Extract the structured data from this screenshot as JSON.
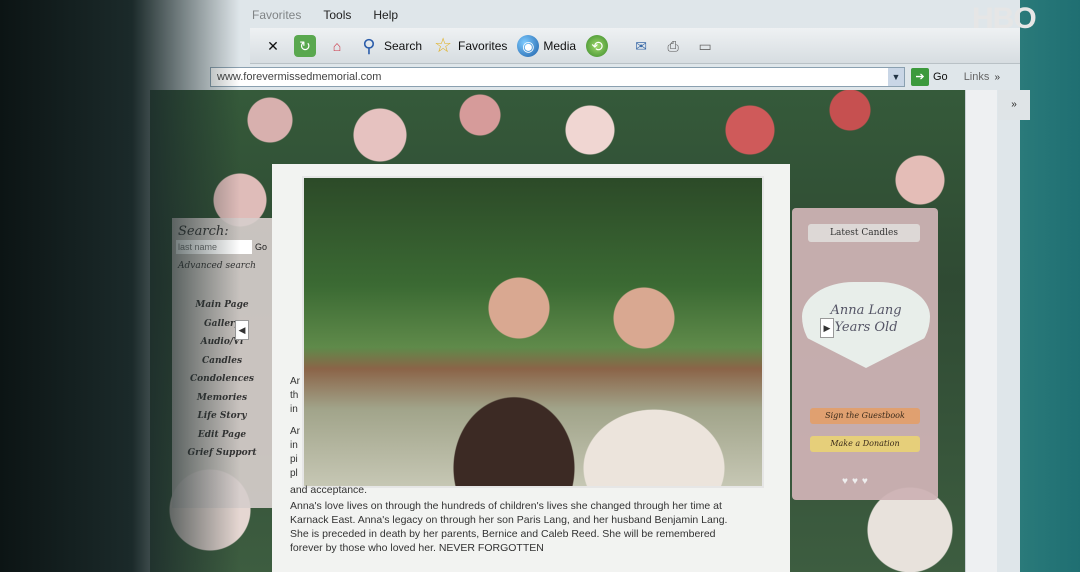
{
  "watermark": "HBO",
  "menubar": {
    "items": [
      "Favorites",
      "Tools",
      "Help"
    ]
  },
  "toolbar": {
    "search": "Search",
    "favorites": "Favorites",
    "media": "Media"
  },
  "addressbar": {
    "url": "www.forevermissedmemorial.com",
    "go": "Go",
    "links": "Links",
    "chevron": "»"
  },
  "sidebar": {
    "search_label": "Search:",
    "search_placeholder": "last name",
    "search_go": "Go",
    "advanced": "Advanced search",
    "nav": [
      "Main Page",
      "Gallery",
      "Audio/Vi",
      "Candles",
      "Condolences",
      "Memories",
      "Life Story",
      "Edit Page",
      "Grief Support"
    ]
  },
  "content": {
    "frag1": "Ar",
    "frag2": "th",
    "frag3": "in",
    "frag4": "Ar",
    "frag5": "in",
    "frag6": "pi",
    "frag7": "pl",
    "line_accept": "and acceptance.",
    "line1": "Anna's love lives on through the hundreds of children's lives she changed through her time at",
    "line2": "Karnack East. Anna's legacy on through her son Paris Lang, and her husband Benjamin Lang.",
    "line3": "She is preceded in death by her parents, Bernice and Caleb Reed. She will be remembered",
    "line4": "forever by those who loved her. NEVER FORGOTTEN"
  },
  "right_panel": {
    "latest": "Latest Candles",
    "heart_line1": "Anna Lang",
    "heart_line2": "Years Old",
    "guestbook": "Sign the Guestbook",
    "donation": "Make a Donation"
  }
}
